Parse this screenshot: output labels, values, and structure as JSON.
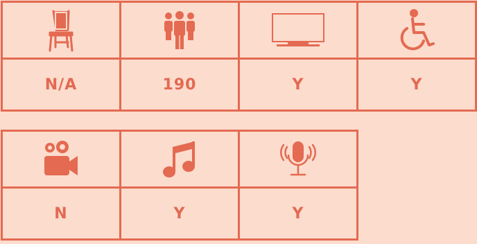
{
  "accent_color": "#e46a52",
  "background_color": "#fcdccd",
  "amenities_row1": [
    {
      "icon": "chair-icon",
      "value": "N/A"
    },
    {
      "icon": "people-group-icon",
      "value": "190"
    },
    {
      "icon": "tv-screen-icon",
      "value": "Y"
    },
    {
      "icon": "wheelchair-accessible-icon",
      "value": "Y"
    }
  ],
  "amenities_row2": [
    {
      "icon": "video-camera-icon",
      "value": "N"
    },
    {
      "icon": "music-note-icon",
      "value": "Y"
    },
    {
      "icon": "microphone-icon",
      "value": "Y"
    }
  ]
}
